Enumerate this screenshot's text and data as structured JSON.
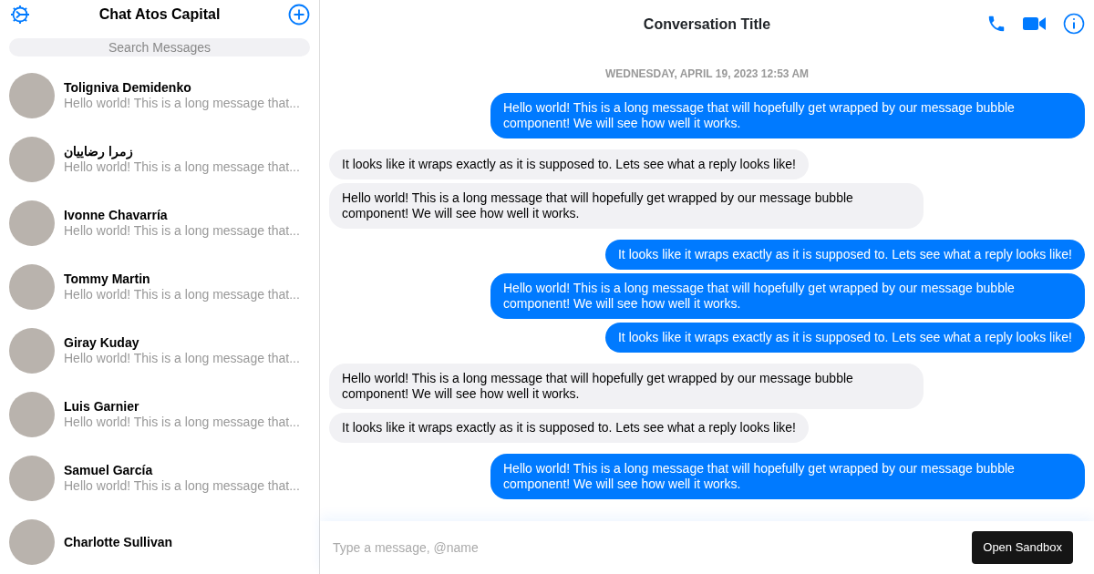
{
  "sidebar": {
    "title": "Chat Atos Capital",
    "search": {
      "placeholder": "Search Messages"
    },
    "conversations": [
      {
        "name": "Toligniva Demidenko",
        "preview": "Hello world! This is a long message that..."
      },
      {
        "name": "زمرا رضاییان",
        "preview": "Hello world! This is a long message that..."
      },
      {
        "name": "Ivonne Chavarría",
        "preview": "Hello world! This is a long message that..."
      },
      {
        "name": "Tommy Martin",
        "preview": "Hello world! This is a long message that..."
      },
      {
        "name": "Giray Kuday",
        "preview": "Hello world! This is a long message that..."
      },
      {
        "name": "Luis Garnier",
        "preview": "Hello world! This is a long message that..."
      },
      {
        "name": "Samuel García",
        "preview": "Hello world! This is a long message that..."
      },
      {
        "name": "Charlotte Sullivan"
      }
    ]
  },
  "conversation": {
    "title": "Conversation Title",
    "date": "WEDNESDAY, APRIL 19, 2023 12:53 AM",
    "messages": [
      {
        "kind": "outgoing",
        "text": "Hello world! This is a long message that will hopefully get wrapped by our message bubble component! We will see how well it works."
      },
      {
        "kind": "incoming",
        "text": "It looks like it wraps exactly as it is supposed to. Lets see what a reply looks like!"
      },
      {
        "kind": "incoming",
        "text": "Hello world! This is a long message that will hopefully get wrapped by our message bubble component! We will see how well it works."
      },
      {
        "kind": "outgoing",
        "text": "It looks like it wraps exactly as it is supposed to. Lets see what a reply looks like!"
      },
      {
        "kind": "outgoing",
        "text": "Hello world! This is a long message that will hopefully get wrapped by our message bubble component! We will see how well it works."
      },
      {
        "kind": "outgoing",
        "text": "It looks like it wraps exactly as it is supposed to. Lets see what a reply looks like!"
      },
      {
        "kind": "incoming",
        "text": "Hello world! This is a long message that will hopefully get wrapped by our message bubble component! We will see how well it works."
      },
      {
        "kind": "incoming",
        "text": "It looks like it wraps exactly as it is supposed to. Lets see what a reply looks like!"
      },
      {
        "kind": "outgoing",
        "text": "Hello world! This is a long message that will hopefully get wrapped by our message bubble component! We will see how well it works."
      }
    ],
    "composer": {
      "placeholder": "Type a message, @name"
    },
    "sandbox_button": "Open Sandbox"
  }
}
